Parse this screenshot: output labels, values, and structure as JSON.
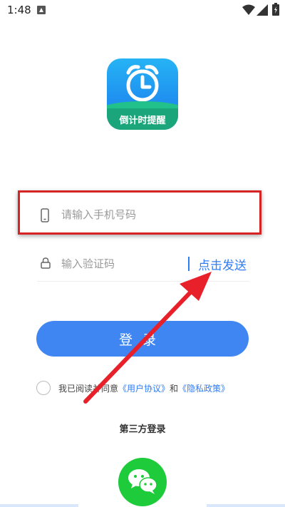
{
  "status_bar": {
    "time": "1:48",
    "icons": [
      "notification-icon",
      "wifi-icon",
      "signal-icon",
      "battery-icon"
    ]
  },
  "app": {
    "brand_name": "倒计时提醒",
    "icon_colors": {
      "sky": "#26b3f5",
      "sea": "#1aa57a"
    }
  },
  "form": {
    "phone_placeholder": "请输入手机号码",
    "code_placeholder": "输入验证码",
    "send_code_label": "点击发送",
    "login_label": "登录"
  },
  "agreement": {
    "prefix": "我已阅读并同意",
    "user_agreement": "《用户协议》",
    "conjunction": "和",
    "privacy_policy": "《隐私政策》"
  },
  "third_party": {
    "title": "第三方登录",
    "providers": [
      "wechat"
    ]
  },
  "annotation": {
    "highlight_color": "#d62424",
    "arrow_color": "#e8202a"
  },
  "colors": {
    "accent": "#3f86f3",
    "link": "#2f7cf6",
    "wechat": "#1ecb3a"
  }
}
